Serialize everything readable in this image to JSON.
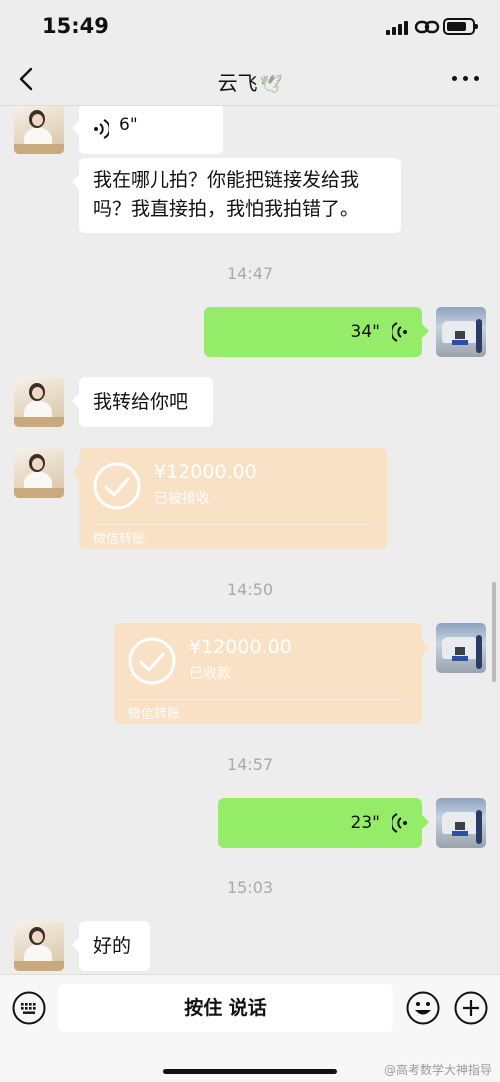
{
  "status_bar": {
    "time": "15:49"
  },
  "header": {
    "title": "云飞",
    "title_icon": "dove-icon"
  },
  "messages": {
    "m1_voice": {
      "duration": "6\""
    },
    "m2_text": {
      "line1": "我在哪儿拍？你能把链接发给我",
      "line2": "吗？我直接拍，我怕我拍错了。"
    },
    "ts1": "14:47",
    "m3_voice": {
      "duration": "34\""
    },
    "m4_text": "我转给你吧",
    "m5_transfer": {
      "amount": "¥12000.00",
      "state": "已被接收",
      "brand": "微信转账"
    },
    "ts2": "14:50",
    "m6_transfer": {
      "amount": "¥12000.00",
      "state": "已收款",
      "brand": "微信转账"
    },
    "ts3": "14:57",
    "m7_voice": {
      "duration": "23\""
    },
    "ts4": "15:03",
    "m8_text": "好的"
  },
  "input_bar": {
    "hold_to_talk": "按住 说话"
  },
  "watermark": "@高考数学大神指导",
  "colors": {
    "outgoing_bubble": "#95ec69",
    "incoming_bubble": "#ffffff",
    "transfer_card": "#f8e1c4",
    "background": "#ededed"
  }
}
